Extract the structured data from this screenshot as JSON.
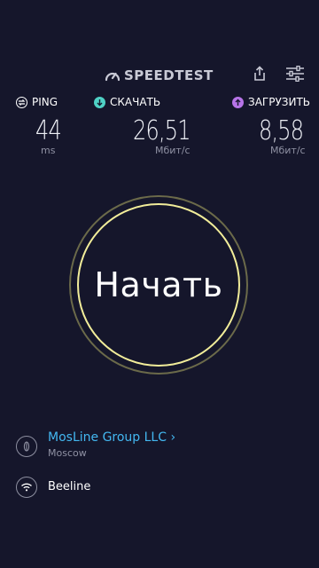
{
  "header": {
    "brand": "SPEEDTEST",
    "share_icon": "share-icon",
    "settings_icon": "settings-sliders-icon"
  },
  "metrics": {
    "ping": {
      "label": "PING",
      "value": "44",
      "unit": "ms",
      "icon": "ping-icon",
      "color": "#ffffff"
    },
    "download": {
      "label": "СКАЧАТЬ",
      "value": "26,51",
      "unit": "Мбит/с",
      "icon": "download-arrow-icon",
      "color": "#4fd1c5"
    },
    "upload": {
      "label": "ЗАГРУЗИТЬ",
      "value": "8,58",
      "unit": "Мбит/с",
      "icon": "upload-arrow-icon",
      "color": "#b774e8"
    }
  },
  "start": {
    "label": "Начать"
  },
  "provider": {
    "isp_name": "MosLine Group LLC",
    "isp_chevron": "›",
    "city": "Moscow",
    "network": "Beeline"
  },
  "colors": {
    "background": "#15162b",
    "accent_ring": "#f2ed9a",
    "link": "#43b7f0"
  }
}
